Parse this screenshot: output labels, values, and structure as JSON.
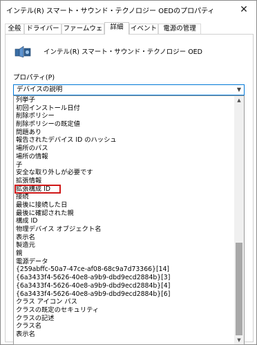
{
  "window": {
    "title": "インテル(R) スマート・サウンド・テクノロジー OEDのプロパティ"
  },
  "tabs": [
    "全般",
    "ドライバー",
    "ファームウェア",
    "詳細",
    "イベント",
    "電源の管理"
  ],
  "active_tab": "詳細",
  "device": {
    "name": "インテル(R) スマート・サウンド・テクノロジー OED",
    "icon": "speaker-icon"
  },
  "property_label": "プロパティ(P)",
  "combo": {
    "selected": "デバイスの説明"
  },
  "dropdown": {
    "items": [
      "列挙子",
      "初回インストール日付",
      "削除ポリシー",
      "削除ポリシーの既定値",
      "問題あり",
      "報告されたデバイス ID のハッシュ",
      "場所のパス",
      "場所の情報",
      "子",
      "安全な取り外しが必要です",
      "拡張情報",
      "拡張構成 ID",
      "接続",
      "最後に接続した日",
      "最後に確認された親",
      "構成 ID",
      "物理デバイス オブジェクト名",
      "表示名",
      "製造元",
      "親",
      "電源データ",
      "{259abffc-50a7-47ce-af08-68c9a7d73366}[14]",
      "{6a3433f4-5626-40e8-a9b9-dbd9ecd2884b}[3]",
      "{6a3433f4-5626-40e8-a9b9-dbd9ecd2884b}[4]",
      "{6a3433f4-5626-40e8-a9b9-dbd9ecd2884b}[6]",
      "クラス アイコン パス",
      "クラスの既定のセキュリティ",
      "クラスの記述",
      "クラス名",
      "表示名"
    ],
    "highlighted_item": "拡張構成 ID",
    "highlight_color": "#d01818"
  }
}
